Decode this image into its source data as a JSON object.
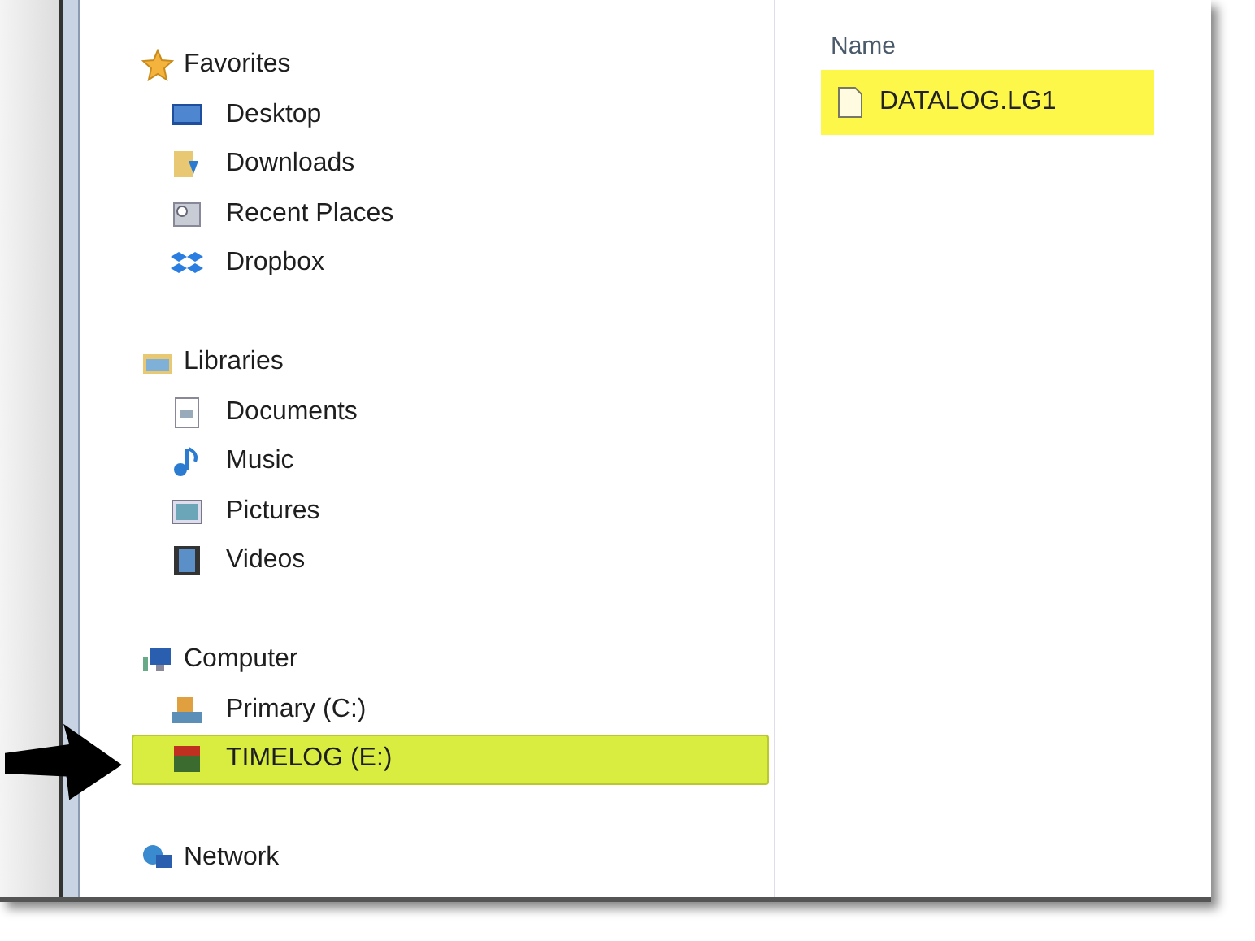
{
  "navigation_pane": {
    "groups": [
      {
        "label": "Favorites",
        "children": [
          {
            "label": "Desktop",
            "selected": false
          },
          {
            "label": "Downloads",
            "selected": false
          },
          {
            "label": "Recent Places",
            "selected": false
          },
          {
            "label": "Dropbox",
            "selected": false
          }
        ]
      },
      {
        "label": "Libraries",
        "children": [
          {
            "label": "Documents",
            "selected": false
          },
          {
            "label": "Music",
            "selected": false
          },
          {
            "label": "Pictures",
            "selected": false
          },
          {
            "label": "Videos",
            "selected": false
          }
        ]
      },
      {
        "label": "Computer",
        "children": [
          {
            "label": "Primary (C:)",
            "selected": false
          },
          {
            "label": "TIMELOG (E:)",
            "selected": true
          }
        ]
      },
      {
        "label": "Network"
      }
    ]
  },
  "file_list": {
    "column_header": "Name",
    "files": [
      {
        "name": "DATALOG.LG1",
        "highlighted": true
      }
    ]
  }
}
